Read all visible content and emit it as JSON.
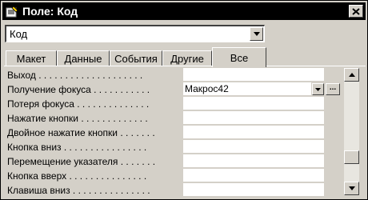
{
  "window": {
    "title": "Поле: Код"
  },
  "object_selector": {
    "value": "Код"
  },
  "tabs": [
    {
      "label": "Макет"
    },
    {
      "label": "Данные"
    },
    {
      "label": "События"
    },
    {
      "label": "Другие"
    },
    {
      "label": "Все",
      "active": true
    }
  ],
  "properties": [
    {
      "label": "Выход . . . . . . . . . . . . . . . . . . . .",
      "value": ""
    },
    {
      "label": "Получение фокуса . . . . . . . . . . .",
      "value": "Макрос42",
      "selected": true
    },
    {
      "label": "Потеря фокуса . . . . . . . . . . . . . .",
      "value": ""
    },
    {
      "label": "Нажатие кнопки . . . . . . . . . . . . .",
      "value": ""
    },
    {
      "label": "Двойное нажатие кнопки . . . . . . .",
      "value": ""
    },
    {
      "label": "Кнопка вниз . . . . . . . . . . . . . . . .",
      "value": ""
    },
    {
      "label": "Перемещение указателя . . . . . . .",
      "value": ""
    },
    {
      "label": "Кнопка вверх . . . . . . . . . . . . . . .",
      "value": ""
    },
    {
      "label": "Клавиша вниз . . . . . . . . . . . . . . .",
      "value": ""
    }
  ],
  "build_button_label": "...",
  "icons": {
    "title": "properties-icon",
    "close": "close-icon",
    "combo_arrow": "chevron-down-icon",
    "scroll_up": "scroll-up-icon",
    "scroll_down": "scroll-down-icon"
  }
}
